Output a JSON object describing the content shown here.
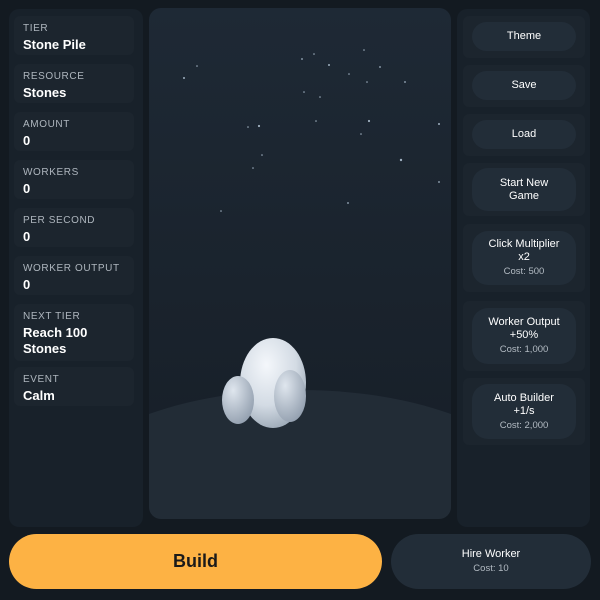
{
  "stats": [
    {
      "label": "TIER",
      "value": "Stone Pile"
    },
    {
      "label": "RESOURCE",
      "value": "Stones"
    },
    {
      "label": "AMOUNT",
      "value": "0"
    },
    {
      "label": "WORKERS",
      "value": "0"
    },
    {
      "label": "PER SECOND",
      "value": "0"
    },
    {
      "label": "WORKER OUTPUT",
      "value": "0"
    },
    {
      "label": "NEXT TIER",
      "value": "Reach 100 Stones"
    },
    {
      "label": "EVENT",
      "value": "Calm"
    }
  ],
  "controls": {
    "theme": "Theme",
    "save": "Save",
    "load": "Load",
    "new_game": "Start New Game"
  },
  "upgrades": [
    {
      "title": "Click Multiplier x2",
      "cost": "Cost: 500"
    },
    {
      "title": "Worker Output +50%",
      "cost": "Cost: 1,000"
    },
    {
      "title": "Auto Builder +1/s",
      "cost": "Cost: 2,000"
    }
  ],
  "actions": {
    "build": "Build",
    "hire_title": "Hire Worker",
    "hire_cost": "Cost: 10"
  },
  "stage": {
    "icon": "stone-pile-icon",
    "sky_color": "#1e2935",
    "ground_color": "#222c36"
  },
  "colors": {
    "accent": "#fdb244",
    "panel": "#18212a",
    "button": "#222d38"
  }
}
